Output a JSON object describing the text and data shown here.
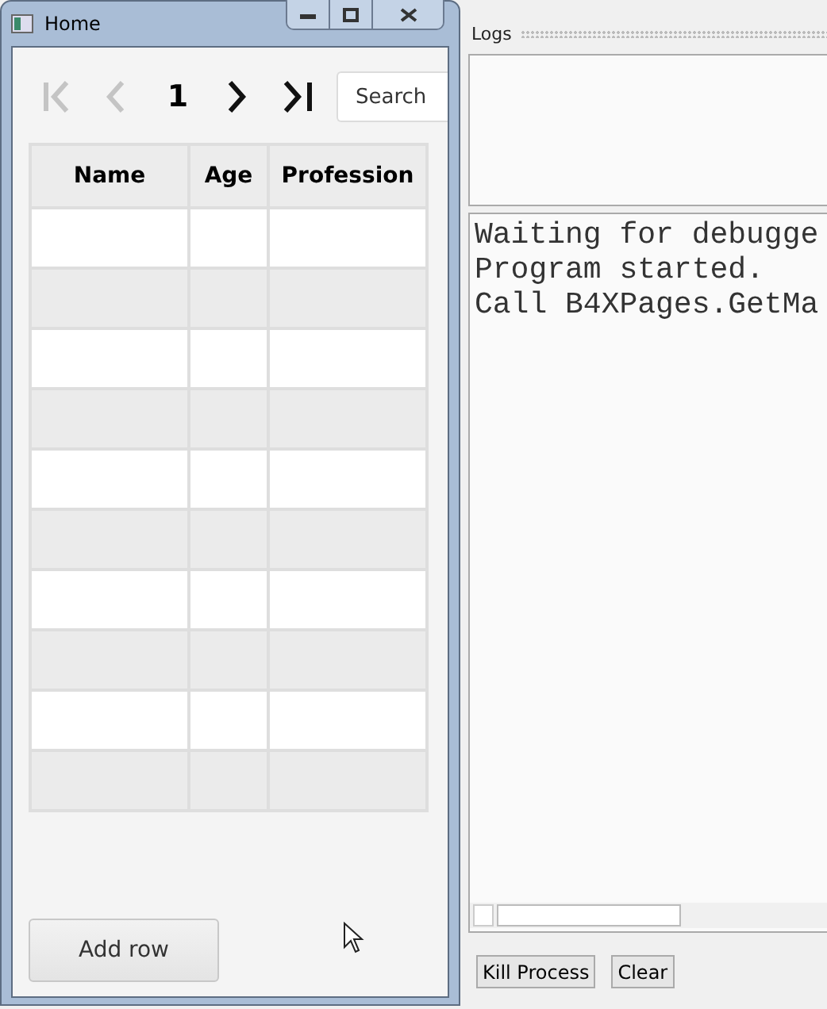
{
  "window": {
    "title": "Home"
  },
  "pager": {
    "buttons": [
      {
        "kind": "first",
        "disabled": true
      },
      {
        "kind": "prev",
        "disabled": true
      },
      {
        "kind": "next",
        "disabled": false
      },
      {
        "kind": "last",
        "disabled": false
      }
    ],
    "page": "1",
    "search": {
      "placeholder": "Search"
    }
  },
  "table": {
    "columns": [
      "Name",
      "Age",
      "Profession"
    ],
    "rows": [
      {
        "kind": "empty"
      },
      {
        "kind": "empty"
      },
      {
        "kind": "empty"
      },
      {
        "kind": "empty"
      },
      {
        "kind": "empty"
      },
      {
        "kind": "empty"
      },
      {
        "kind": "empty"
      },
      {
        "kind": "empty"
      },
      {
        "kind": "empty"
      },
      {
        "kind": "empty"
      }
    ]
  },
  "add_button": "Add row",
  "logs": {
    "title": "Logs",
    "lines": [
      "Waiting for debugge",
      "Program started.",
      "Call B4XPages.GetMa"
    ],
    "buttons": [
      "Kill Process",
      "Clear"
    ]
  }
}
